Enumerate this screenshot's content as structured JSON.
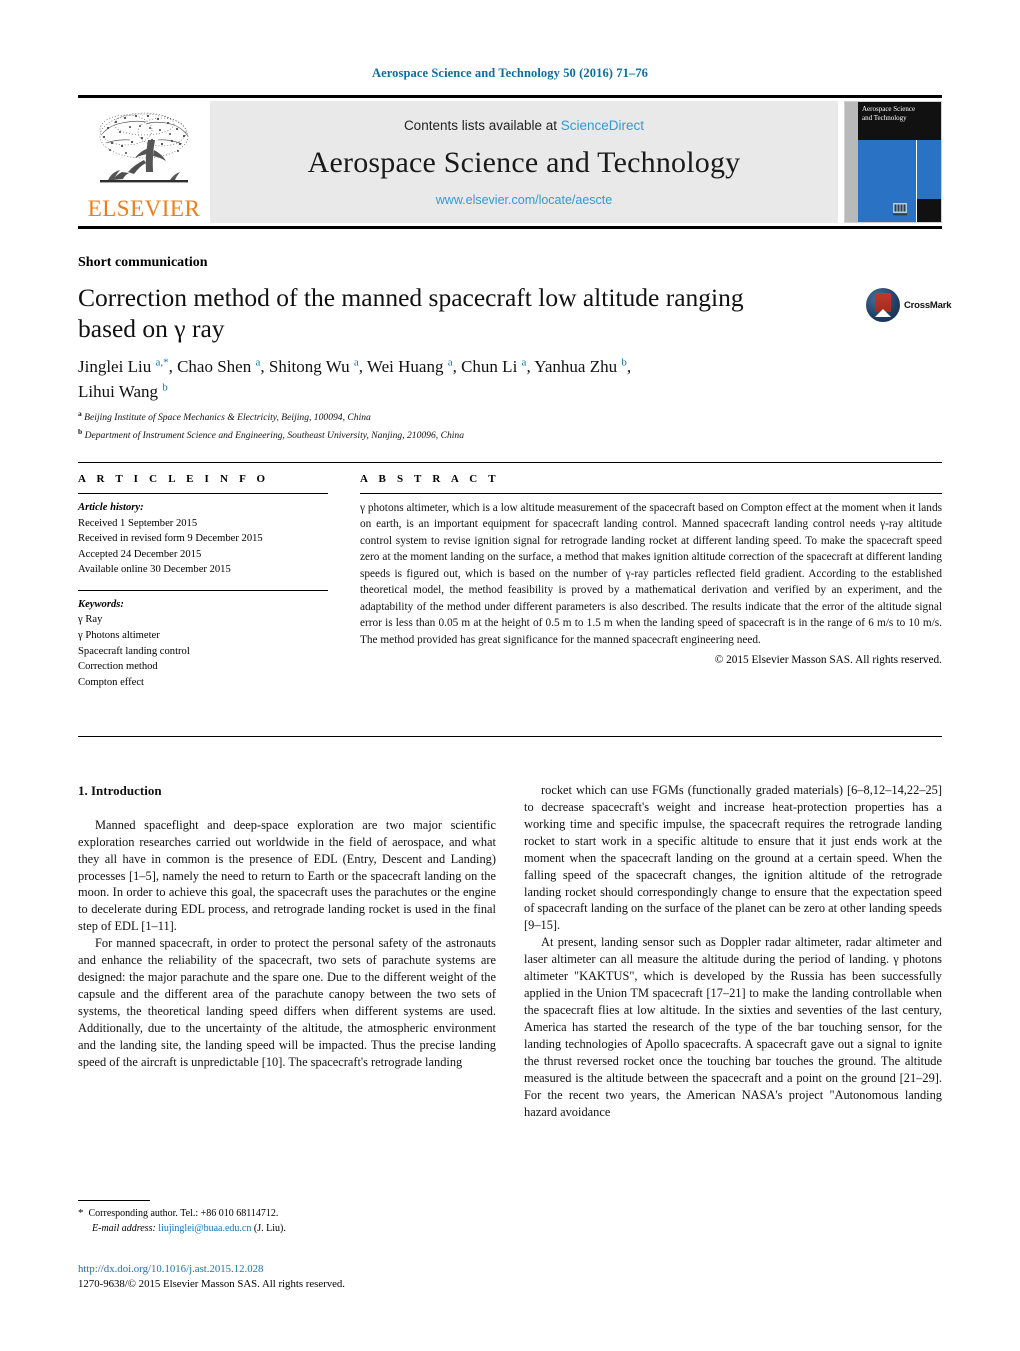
{
  "running_head": "Aerospace Science and Technology 50 (2016) 71–76",
  "masthead": {
    "publisher_name": "ELSEVIER",
    "contents_prefix": "Contents lists available at ",
    "sciencedirect": "ScienceDirect",
    "journal_name": "Aerospace Science and Technology",
    "journal_url": "www.elsevier.com/locate/aescte",
    "cover_title": "Aerospace Science and Technology"
  },
  "article": {
    "type": "Short communication",
    "title": "Correction method of the manned spacecraft low altitude ranging based on γ ray",
    "crossmark_label": "CrossMark",
    "authors_line1": "Jinglei Liu a,*, Chao Shen a, Shitong Wu a, Wei Huang a, Chun Li a, Yanhua Zhu b,",
    "authors_line2": "Lihui Wang b",
    "affiliations": [
      {
        "marker": "a",
        "text": "Beijing Institute of Space Mechanics & Electricity, Beijing, 100094, China"
      },
      {
        "marker": "b",
        "text": "Department of Instrument Science and Engineering, Southeast University, Nanjing, 210096, China"
      }
    ]
  },
  "info": {
    "heading": "A R T I C L E   I N F O",
    "history_label": "Article history:",
    "history": [
      "Received 1 September 2015",
      "Received in revised form 9 December 2015",
      "Accepted 24 December 2015",
      "Available online 30 December 2015"
    ],
    "keywords_label": "Keywords:",
    "keywords": [
      "γ Ray",
      "γ Photons altimeter",
      "Spacecraft landing control",
      "Correction method",
      "Compton effect"
    ]
  },
  "abstract": {
    "heading": "A B S T R A C T",
    "text": "γ photons altimeter, which is a low altitude measurement of the spacecraft based on Compton effect at the moment when it lands on earth, is an important equipment for spacecraft landing control. Manned spacecraft landing control needs γ-ray altitude control system to revise ignition signal for retrograde landing rocket at different landing speed. To make the spacecraft speed zero at the moment landing on the surface, a method that makes ignition altitude correction of the spacecraft at different landing speeds is figured out, which is based on the number of γ-ray particles reflected field gradient. According to the established theoretical model, the method feasibility is proved by a mathematical derivation and verified by an experiment, and the adaptability of the method under different parameters is also described. The results indicate that the error of the altitude signal error is less than 0.05 m at the height of 0.5 m to 1.5 m when the landing speed of spacecraft is in the range of 6 m/s to 10 m/s. The method provided has great significance for the manned spacecraft engineering need.",
    "copyright": "© 2015 Elsevier Masson SAS. All rights reserved."
  },
  "body": {
    "section_title": "1. Introduction",
    "left_paragraphs": [
      "Manned spaceflight and deep-space exploration are two major scientific exploration researches carried out worldwide in the field of aerospace, and what they all have in common is the presence of EDL (Entry, Descent and Landing) processes [1–5], namely the need to return to Earth or the spacecraft landing on the moon. In order to achieve this goal, the spacecraft uses the parachutes or the engine to decelerate during EDL process, and retrograde landing rocket is used in the final step of EDL [1–11].",
      "For manned spacecraft, in order to protect the personal safety of the astronauts and enhance the reliability of the spacecraft, two sets of parachute systems are designed: the major parachute and the spare one. Due to the different weight of the capsule and the different area of the parachute canopy between the two sets of systems, the theoretical landing speed differs when different systems are used. Additionally, due to the uncertainty of the altitude, the atmospheric environment and the landing site, the landing speed will be impacted. Thus the precise landing speed of the aircraft is unpredictable [10]. The spacecraft's retrograde landing"
    ],
    "right_paragraphs": [
      "rocket which can use FGMs (functionally graded materials) [6–8,12–14,22–25] to decrease spacecraft's weight and increase heat-protection properties has a working time and specific impulse, the spacecraft requires the retrograde landing rocket to start work in a specific altitude to ensure that it just ends work at the moment when the spacecraft landing on the ground at a certain speed. When the falling speed of the spacecraft changes, the ignition altitude of the retrograde landing rocket should correspondingly change to ensure that the expectation speed of spacecraft landing on the surface of the planet can be zero at other landing speeds [9–15].",
      "At present, landing sensor such as Doppler radar altimeter, radar altimeter and laser altimeter can all measure the altitude during the period of landing. γ photons altimeter \"KAKTUS\", which is developed by the Russia has been successfully applied in the Union TM spacecraft [17–21] to make the landing controllable when the spacecraft flies at low altitude. In the sixties and seventies of the last century, America has started the research of the type of the bar touching sensor, for the landing technologies of Apollo spacecrafts. A spacecraft gave out a signal to ignite the thrust reversed rocket once the touching bar touches the ground. The altitude measured is the altitude between the spacecraft and a point on the ground [21–29]. For the recent two years, the American NASA's project \"Autonomous landing hazard avoidance"
    ]
  },
  "footnote": {
    "corresponding": "Corresponding author. Tel.: +86 010 68114712.",
    "email_label": "E-mail address:",
    "email": "liujinglei@buaa.edu.cn",
    "email_suffix": "(J. Liu)."
  },
  "doi_block": {
    "doi": "http://dx.doi.org/10.1016/j.ast.2015.12.028",
    "issn_line": "1270-9638/© 2015 Elsevier Masson SAS. All rights reserved."
  },
  "colors": {
    "link_blue": "#1577b0",
    "header_blue": "#0b6e9e",
    "sciencedirect_blue": "#2f9bd7",
    "elsevier_orange": "#f07c17",
    "cover_blue": "#2a72c4"
  }
}
